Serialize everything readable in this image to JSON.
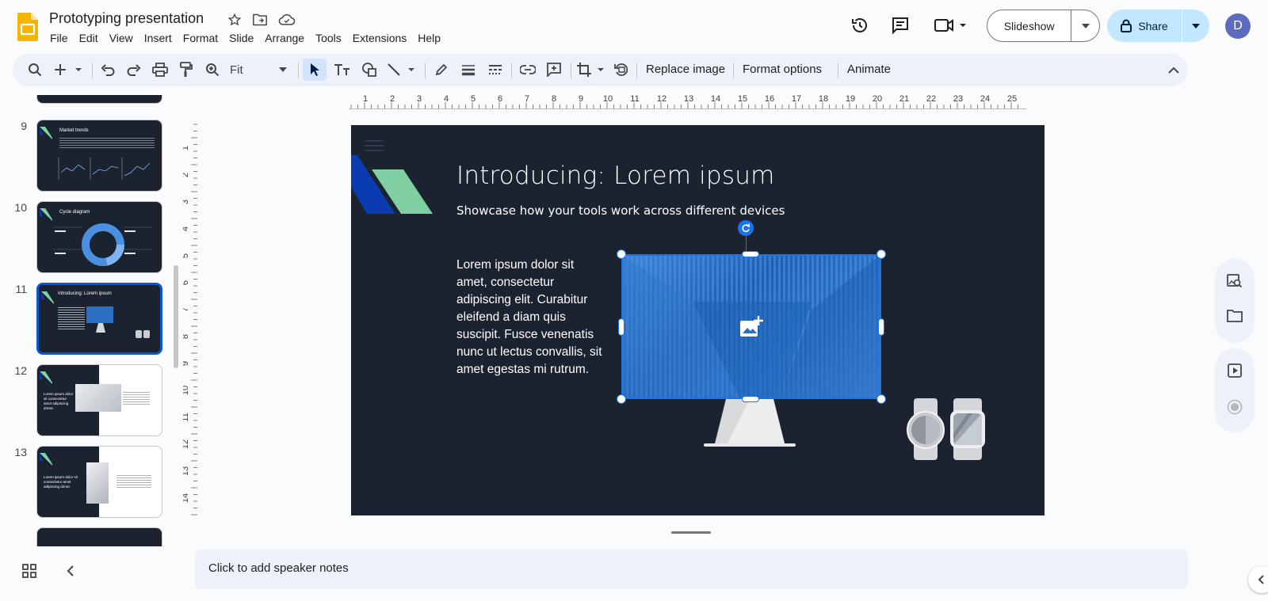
{
  "app": {
    "title": "Prototyping presentation",
    "avatar_letter": "D",
    "accent": "#0b57d0",
    "share_bg": "#c2e7ff"
  },
  "menu": [
    "File",
    "Edit",
    "View",
    "Insert",
    "Format",
    "Slide",
    "Arrange",
    "Tools",
    "Extensions",
    "Help"
  ],
  "header": {
    "slideshow_label": "Slideshow",
    "share_label": "Share"
  },
  "toolbar": {
    "zoom_value": "Fit",
    "replace_image": "Replace image",
    "format_options": "Format options",
    "animate": "Animate"
  },
  "rulers": {
    "horizontal": [
      "1",
      "2",
      "3",
      "4",
      "5",
      "6",
      "7",
      "8",
      "9",
      "10",
      "11",
      "12",
      "13",
      "14",
      "15",
      "16",
      "17",
      "18",
      "19",
      "20",
      "21",
      "22",
      "23",
      "24",
      "25"
    ],
    "vertical": [
      "1",
      "2",
      "3",
      "4",
      "5",
      "6",
      "7",
      "8",
      "9",
      "10",
      "11",
      "12",
      "13",
      "14"
    ]
  },
  "filmstrip": {
    "slides": [
      {
        "number": "9",
        "title": "Market trends"
      },
      {
        "number": "10",
        "title": "Cycle diagram"
      },
      {
        "number": "11",
        "title": "Introducing: Lorem ipsum",
        "selected": true
      },
      {
        "number": "12",
        "title": "Lorem ipsum dolor sit consectetur amet adipiscing donec"
      },
      {
        "number": "13",
        "title": "Lorem ipsum dolor sit consectetur amet adipiscing donec"
      }
    ]
  },
  "slide": {
    "title": "Introducing: Lorem ipsum",
    "subtitle": "Showcase how your tools work across different devices",
    "body": "Lorem ipsum dolor sit amet, consectetur adipiscing elit. Curabitur eleifend a diam quis suscipit. Fusce venenatis nunc ut lectus convallis, sit amet egestas mi rutrum."
  },
  "notes": {
    "placeholder": "Click to add speaker notes"
  },
  "icons": {
    "toolbar": [
      "search-icon",
      "add-icon",
      "undo-icon",
      "redo-icon",
      "print-icon",
      "paint-format-icon",
      "zoom-icon",
      "select-icon",
      "text-box-icon",
      "shape-icon",
      "line-icon",
      "pen-icon",
      "border-weight-icon",
      "border-dash-icon",
      "link-icon",
      "comment-icon",
      "crop-icon",
      "reset-image-icon",
      "collapse-icon"
    ],
    "side_panel": [
      "image-search-icon",
      "folder-icon",
      "play-icon",
      "record-icon"
    ]
  }
}
